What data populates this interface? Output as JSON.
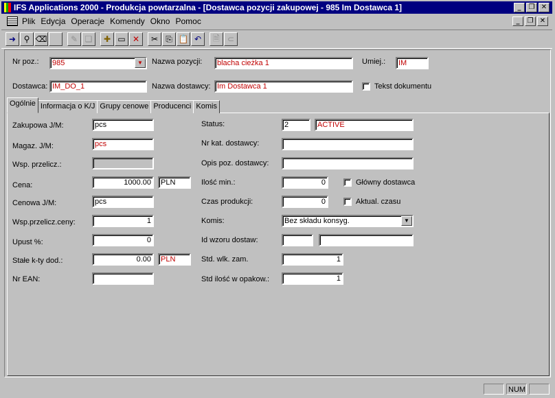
{
  "window": {
    "title": "IFS Applications 2000 - Produkcja powtarzalna - [Dostawca pozycji zakupowej - 985 Im Dostawca 1]"
  },
  "menu": {
    "items": [
      "Plik",
      "Edycja",
      "Operacje",
      "Komendy",
      "Okno",
      "Pomoc"
    ]
  },
  "toolbar": {
    "buttons": [
      "populate-icon",
      "find-icon",
      "clear-icon",
      "blank-icon",
      "edit-icon",
      "duplicate-icon",
      "new-icon",
      "open-icon",
      "delete-icon",
      "cut-icon",
      "copy-icon",
      "paste-icon",
      "undo-icon",
      "document-icon",
      "attach-icon"
    ]
  },
  "header": {
    "part_no_label": "Nr poz.:",
    "part_no": "985",
    "part_name_label": "Nazwa pozycji:",
    "part_name": "blacha cieżka 1",
    "location_label": "Umiej.:",
    "location": "IM",
    "supplier_label": "Dostawca:",
    "supplier": "IM_DO_1",
    "supplier_name_label": "Nazwa dostawcy:",
    "supplier_name": "Im Dostawca 1",
    "document_text_label": "Tekst dokumentu"
  },
  "tabs": [
    "Ogólnie",
    "Informacja o K/J",
    "Grupy cenowe",
    "Producenci",
    "Komis"
  ],
  "general": {
    "purch_uom_label": "Zakupowa J/M:",
    "purch_uom": "pcs",
    "inv_uom_label": "Magaz. J/M:",
    "inv_uom": "pcs",
    "conv_factor_label": "Wsp. przelicz.:",
    "conv_factor": "",
    "price_label": "Cena:",
    "price": "1000.00",
    "price_currency": "PLN",
    "price_uom_label": "Cenowa J/M:",
    "price_uom": "pcs",
    "price_conv_label": "Wsp.przelicz.ceny:",
    "price_conv": "1",
    "discount_label": "Upust %:",
    "discount": "0",
    "add_cost_label": "Stałe k-ty dod.:",
    "add_cost": "0.00",
    "add_cost_currency": "PLN",
    "ean_label": "Nr EAN:",
    "ean": "",
    "status_label": "Status:",
    "status_code": "2",
    "status_text": "ACTIVE",
    "supplier_cat_label": "Nr kat. dostawcy:",
    "supplier_cat": "",
    "supplier_desc_label": "Opis poz. dostawcy:",
    "supplier_desc": "",
    "min_qty_label": "Ilość min.:",
    "min_qty": "0",
    "primary_supplier_label": "Główny dostawca",
    "lead_time_label": "Czas produkcji:",
    "lead_time": "0",
    "update_time_label": "Aktual. czasu",
    "consignment_label": "Komis:",
    "consignment": "Bez składu konsyg.",
    "template_label": "Id wzoru dostaw:",
    "template_id": "",
    "template_desc": "",
    "std_order_label": "Std. wlk. zam.",
    "std_order": "1",
    "std_pack_label": "Std ilość w opakow.:",
    "std_pack": "1"
  },
  "statusbar": {
    "num": "NUM"
  }
}
